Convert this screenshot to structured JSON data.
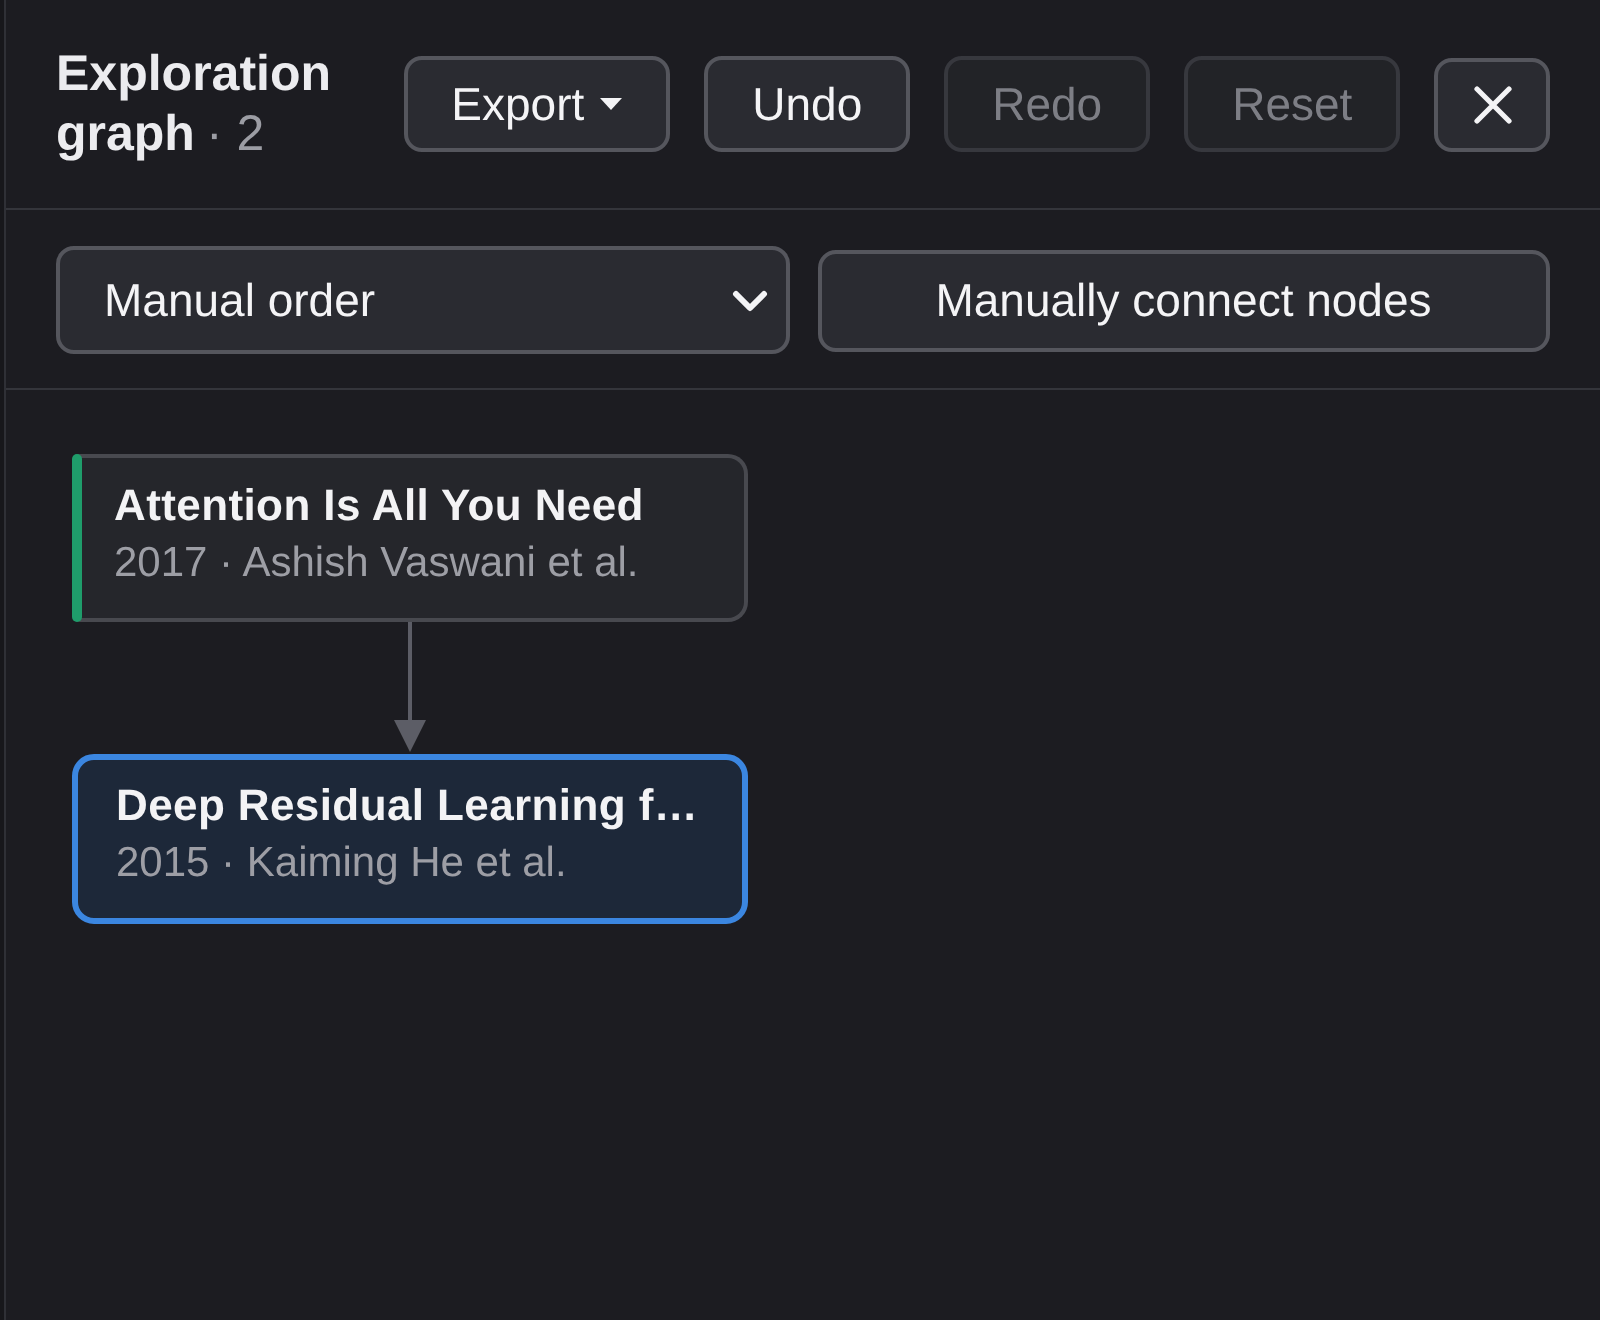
{
  "header": {
    "title": "Exploration graph",
    "count": "· 2",
    "buttons": [
      {
        "kind": "menu",
        "label": "Export",
        "disabled": false
      },
      {
        "kind": "plain",
        "label": "Undo",
        "disabled": false
      },
      {
        "kind": "plain",
        "label": "Redo",
        "disabled": true
      },
      {
        "kind": "plain",
        "label": "Reset",
        "disabled": true
      },
      {
        "kind": "close",
        "disabled": false
      }
    ]
  },
  "controls": {
    "sort_select": {
      "value": "Manual order"
    },
    "connect_button": {
      "label": "Manually connect nodes"
    }
  },
  "graph": {
    "nodes": [
      {
        "title": "Attention Is All You Need",
        "meta": "2017 · Ashish Vaswani et al.",
        "selected": false,
        "color": "#1f9d6b",
        "children": [
          {
            "title": "Deep Residual Learning f…",
            "meta": "2015 · Kaiming He et al.",
            "selected": true
          }
        ]
      }
    ]
  }
}
